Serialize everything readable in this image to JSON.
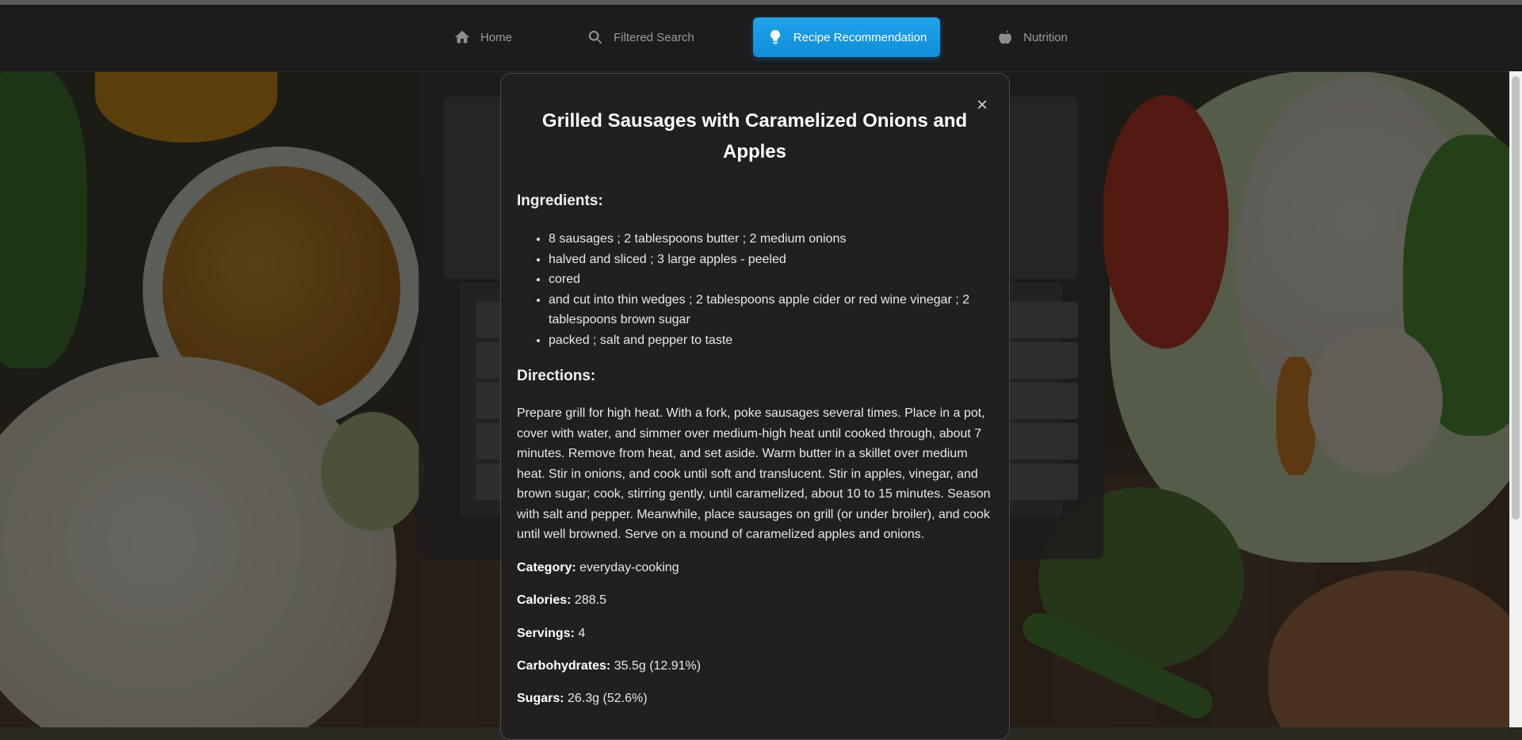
{
  "nav": {
    "items": [
      {
        "label": "Home",
        "icon": "home-icon"
      },
      {
        "label": "Filtered Search",
        "icon": "search-icon"
      },
      {
        "label": "Recipe Recommendation",
        "icon": "lightbulb-icon",
        "active": true
      },
      {
        "label": "Nutrition",
        "icon": "apple-icon"
      }
    ],
    "active_color": "#1a9be6"
  },
  "modal": {
    "close_symbol": "×",
    "title": "Grilled Sausages with Caramelized Onions and Apples",
    "ingredients_heading": "Ingredients:",
    "ingredients": [
      "8 sausages ; 2 tablespoons butter ; 2 medium onions",
      "halved and sliced ; 3 large apples - peeled",
      "cored",
      "and cut into thin wedges ; 2 tablespoons apple cider or red wine vinegar ; 2 tablespoons brown sugar",
      "packed ; salt and pepper to taste"
    ],
    "directions_heading": "Directions:",
    "directions": "Prepare grill for high heat. With a fork, poke sausages several times. Place in a pot, cover with water, and simmer over medium-high heat until cooked through, about 7 minutes. Remove from heat, and set aside. Warm butter in a skillet over medium heat. Stir in onions, and cook until soft and translucent. Stir in apples, vinegar, and brown sugar; cook, stirring gently, until caramelized, about 10 to 15 minutes. Season with salt and pepper. Meanwhile, place sausages on grill (or under broiler), and cook until well browned. Serve on a mound of caramelized apples and onions.",
    "stats": [
      {
        "label": "Category:",
        "value": "everyday-cooking"
      },
      {
        "label": "Calories:",
        "value": "288.5"
      },
      {
        "label": "Servings:",
        "value": "4"
      },
      {
        "label": "Carbohydrates:",
        "value": "35.5g (12.91%)"
      },
      {
        "label": "Sugars:",
        "value": "26.3g (52.6%)"
      }
    ]
  }
}
